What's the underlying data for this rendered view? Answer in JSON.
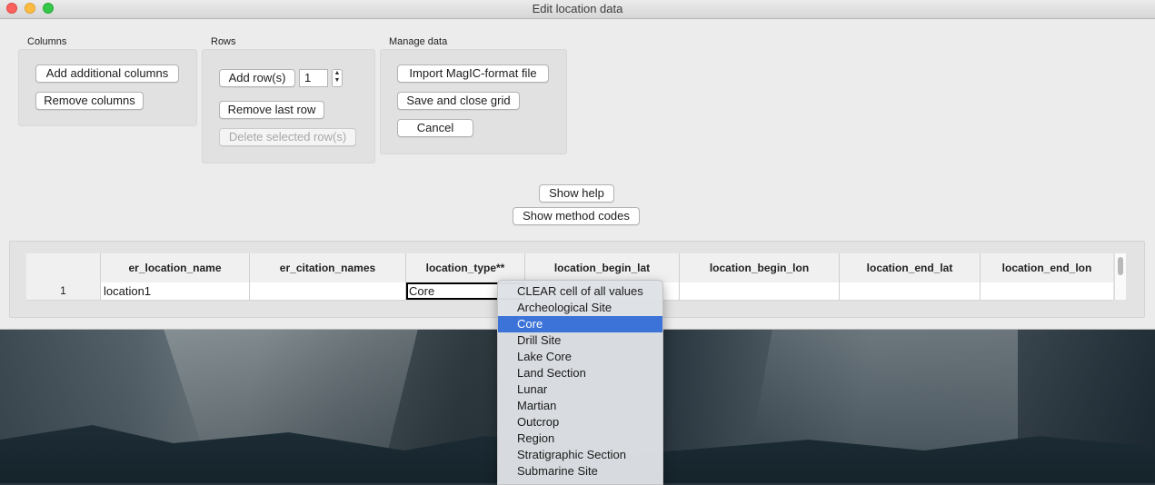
{
  "window": {
    "title": "Edit location data"
  },
  "columns_group": {
    "label": "Columns",
    "add_label": "Add additional columns",
    "remove_label": "Remove columns"
  },
  "rows_group": {
    "label": "Rows",
    "add_label": "Add row(s)",
    "count_value": "1",
    "remove_last_label": "Remove last row",
    "delete_selected_label": "Delete selected row(s)"
  },
  "manage_group": {
    "label": "Manage data",
    "import_label": "Import MagIC-format file",
    "save_label": "Save and close grid",
    "cancel_label": "Cancel"
  },
  "help": {
    "show_help_label": "Show help",
    "method_codes_label": "Show method codes"
  },
  "grid": {
    "headers": [
      "",
      "er_location_name",
      "er_citation_names",
      "location_type**",
      "location_begin_lat",
      "location_begin_lon",
      "location_end_lat",
      "location_end_lon"
    ],
    "rows": [
      [
        "1",
        "location1",
        "",
        "Core",
        "",
        "",
        "",
        ""
      ]
    ]
  },
  "dropdown": {
    "items": [
      "CLEAR cell of all values",
      "Archeological Site",
      "Core",
      "Drill Site",
      "Lake Core",
      "Land Section",
      "Lunar",
      "Martian",
      "Outcrop",
      "Region",
      "Stratigraphic Section",
      "Submarine Site"
    ],
    "selected": "Core"
  }
}
